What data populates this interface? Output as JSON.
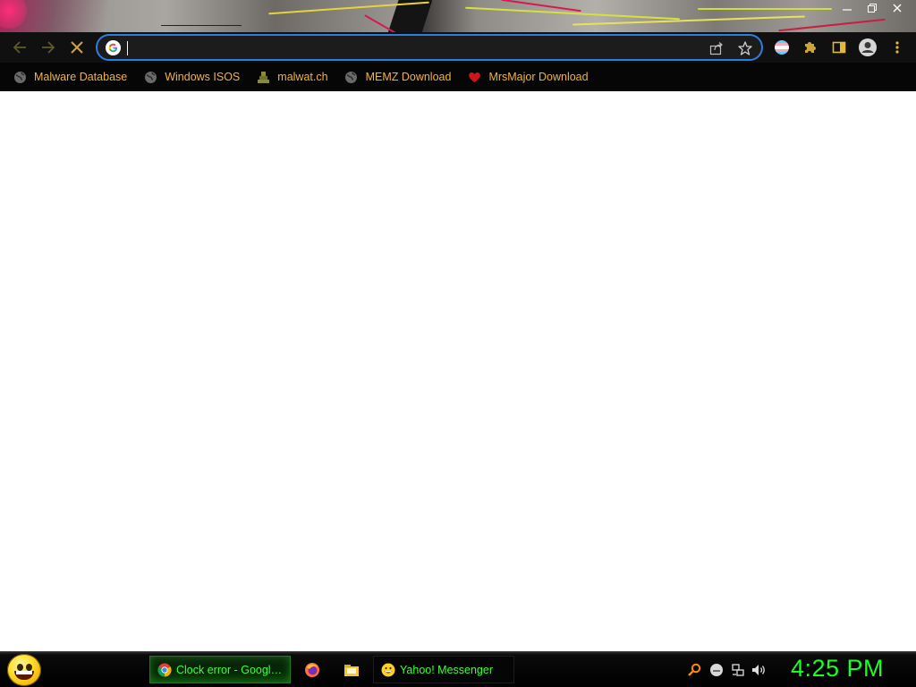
{
  "browser": {
    "omnibox": {
      "value": "",
      "placeholder": ""
    },
    "bookmarks": [
      {
        "label": "Malware Database",
        "icon": "globe-icon"
      },
      {
        "label": "Windows ISOS",
        "icon": "globe-icon"
      },
      {
        "label": "malwat.ch",
        "icon": "malwatch-icon"
      },
      {
        "label": "MEMZ Download",
        "icon": "globe-icon"
      },
      {
        "label": "MrsMajor Download",
        "icon": "heart-icon"
      }
    ],
    "colors": {
      "bookmark_text": "#f1b43a",
      "omnibox_border": "#2f7dde",
      "toolbar_bg": "#101010"
    }
  },
  "taskbar": {
    "tasks": [
      {
        "label": "Clock error - Google ...",
        "icon": "chrome-icon",
        "active": true
      },
      {
        "label": "Yahoo! Messenger",
        "icon": "yahoo-smiley-icon",
        "active": false
      }
    ],
    "pinned": [
      "firefox-icon",
      "folder-icon"
    ],
    "tray": [
      "search-icon",
      "smiley-icon",
      "network-icon",
      "volume-icon"
    ],
    "clock": "4:25 PM",
    "colors": {
      "text": "#3dff3d",
      "clock": "#18ff28"
    }
  }
}
